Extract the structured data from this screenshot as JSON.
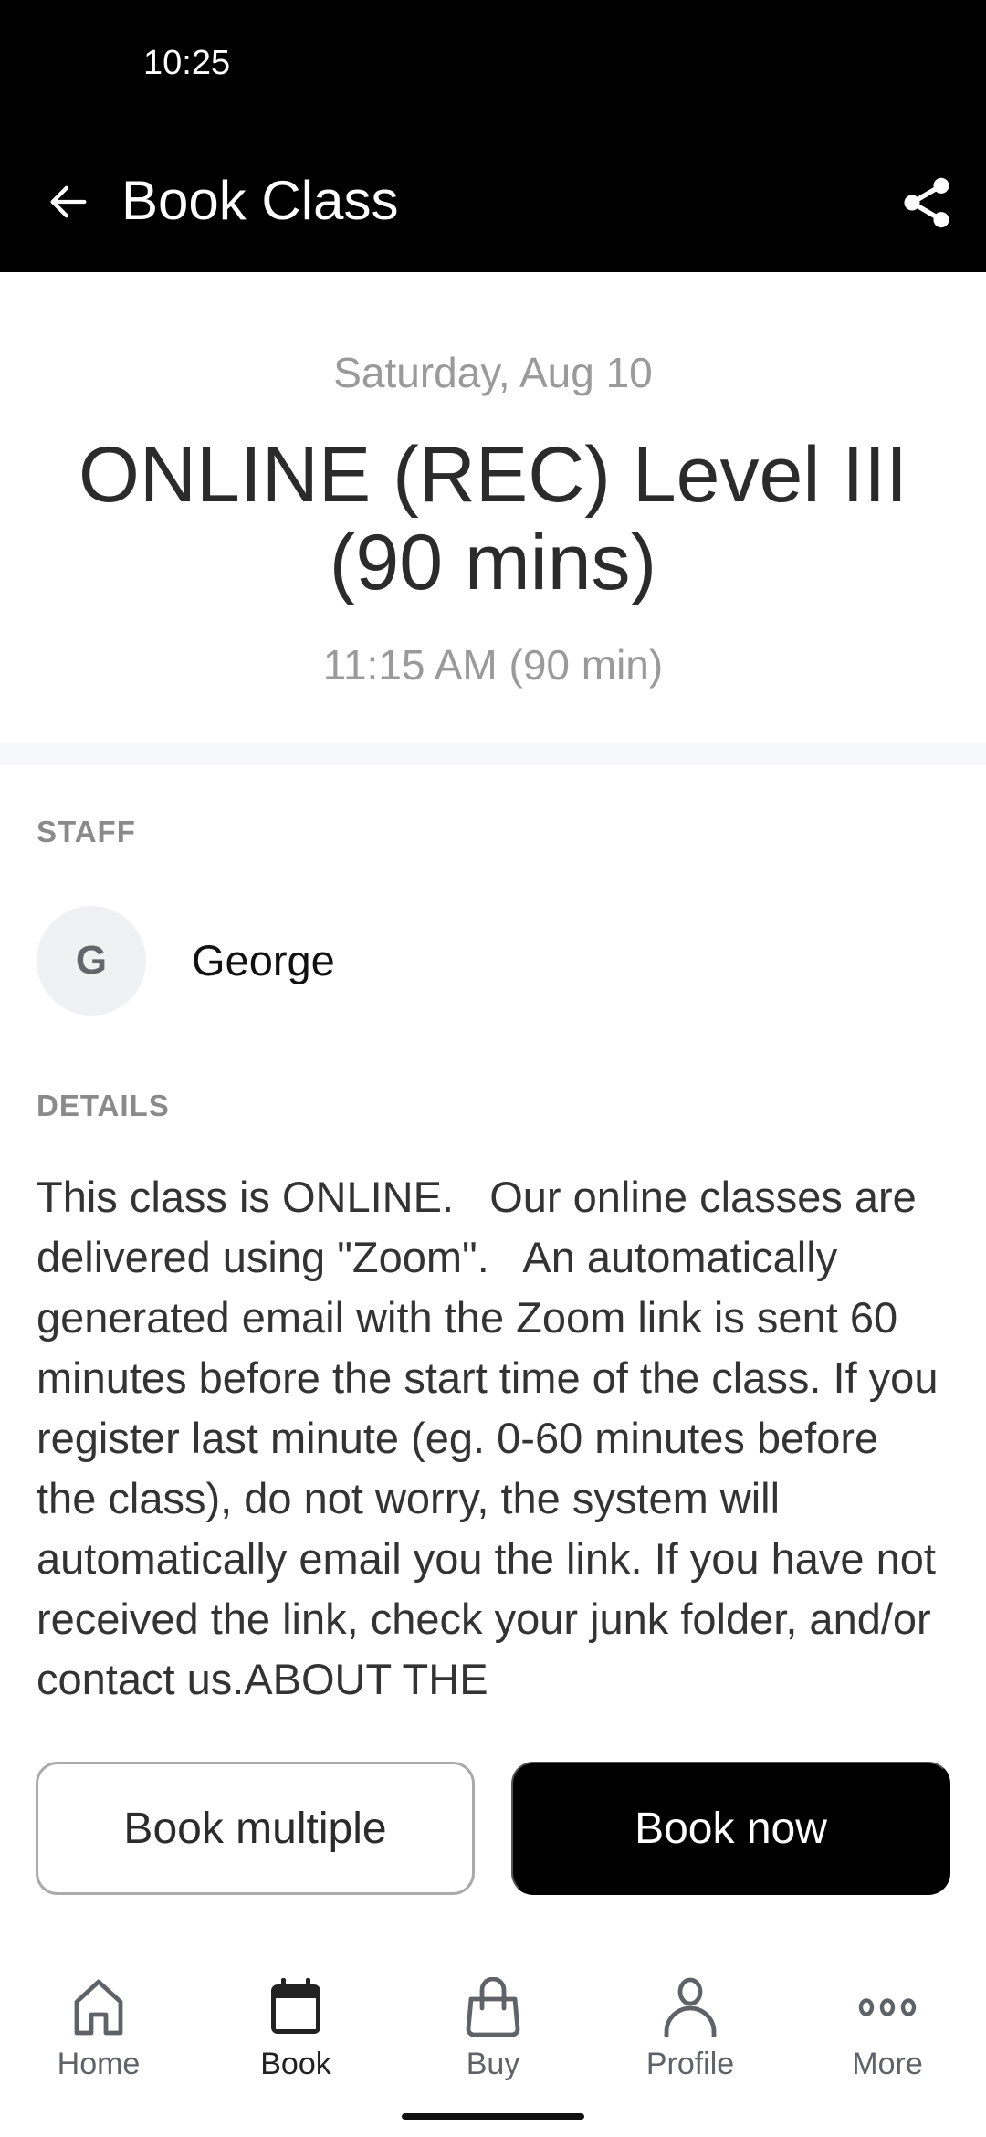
{
  "status_bar": {
    "time": "10:25"
  },
  "app_bar": {
    "title": "Book Class",
    "back_icon": "arrow-left-icon",
    "share_icon": "share-icon"
  },
  "class": {
    "date": "Saturday, Aug 10",
    "title": "ONLINE (REC) Level III (90 mins)",
    "time": "11:15 AM (90 min)"
  },
  "staff": {
    "label": "STAFF",
    "members": [
      {
        "initial": "G",
        "name": "George"
      }
    ]
  },
  "details": {
    "label": "DETAILS",
    "text": "This class is ONLINE.   Our online classes are delivered using \"Zoom\".   An automatically generated email with the Zoom link is sent 60 minutes before the start time of the class. If you register last minute (eg. 0-60 minutes before the class), do not worry, the system will automatically email you the link. If you have not received the link, check your junk folder, and/or contact us.ABOUT THE"
  },
  "actions": {
    "book_multiple": "Book multiple",
    "book_now": "Book now"
  },
  "bottom_nav": {
    "items": [
      {
        "label": "Home",
        "icon": "home-icon",
        "active": false
      },
      {
        "label": "Book",
        "icon": "calendar-icon",
        "active": true
      },
      {
        "label": "Buy",
        "icon": "shopping-bag-icon",
        "active": false
      },
      {
        "label": "Profile",
        "icon": "person-icon",
        "active": false
      },
      {
        "label": "More",
        "icon": "more-horizontal-icon",
        "active": false
      }
    ]
  },
  "colors": {
    "app_bar_bg": "#000000",
    "primary_button_bg": "#000000",
    "secondary_text": "#9a9a9a",
    "section_label": "#8a8a8a",
    "separator": "#f7f8fa"
  }
}
